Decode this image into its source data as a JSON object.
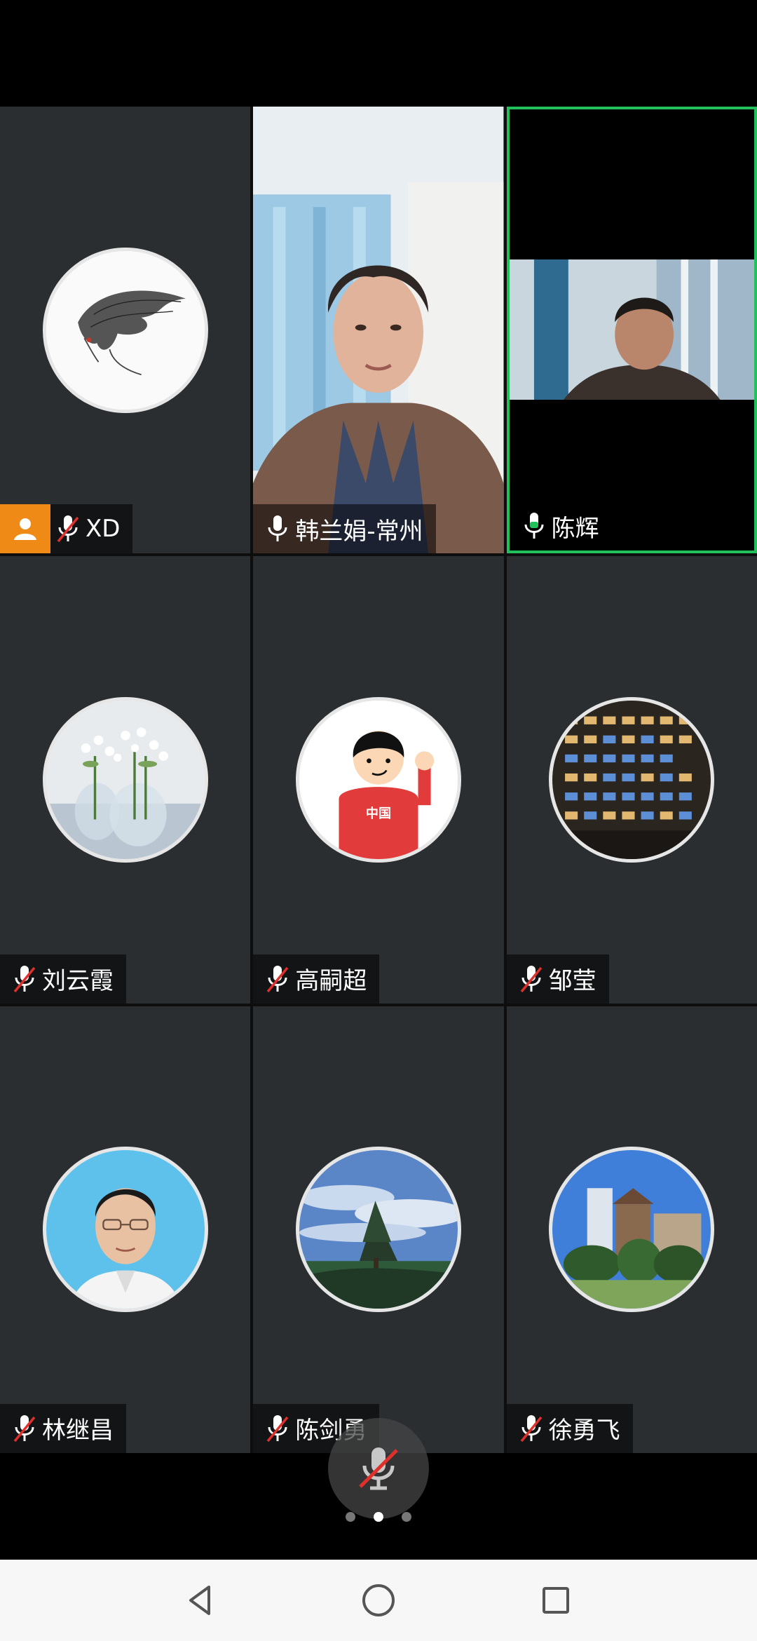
{
  "participants": [
    {
      "name": "XD",
      "muted": true,
      "host": true,
      "avatar": "sketch-portrait-avatar"
    },
    {
      "name": "韩兰娟-常州",
      "muted": false,
      "video": true
    },
    {
      "name": "陈辉",
      "muted": false,
      "video": true,
      "speaking": true
    },
    {
      "name": "刘云霞",
      "muted": true,
      "avatar": "flowers-avatar"
    },
    {
      "name": "高嗣超",
      "muted": true,
      "avatar": "cartoon-boy-avatar"
    },
    {
      "name": "邹莹",
      "muted": true,
      "avatar": "building-lights-avatar"
    },
    {
      "name": "林继昌",
      "muted": true,
      "avatar": "portrait-photo-avatar"
    },
    {
      "name": "陈剑勇",
      "muted": true,
      "avatar": "sky-tree-avatar"
    },
    {
      "name": "徐勇飞",
      "muted": true,
      "avatar": "campus-avatar"
    }
  ],
  "pagination": {
    "pages": 3,
    "current": 2
  },
  "colors": {
    "active_border": "#21c05a",
    "host_badge": "#f08a16",
    "mute_slash": "#e0302c",
    "tile_bg": "#2b2e31"
  },
  "cartoon_shirt_text": "中国"
}
